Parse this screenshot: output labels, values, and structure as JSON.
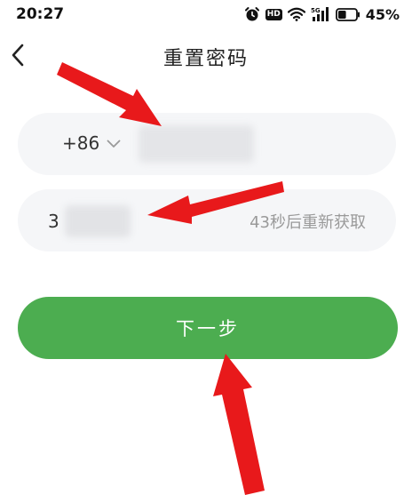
{
  "status_bar": {
    "time": "20:27",
    "network": "5G",
    "hd_label": "HD",
    "battery_percent": "45%",
    "battery_level": 0.45,
    "icons": [
      "alarm-icon",
      "hd-icon",
      "wifi-icon",
      "signal-icon",
      "battery-icon"
    ]
  },
  "header": {
    "title": "重置密码",
    "back_icon": "chevron-left-icon"
  },
  "phone_field": {
    "country_code": "+86",
    "dropdown_icon": "chevron-down-icon",
    "value_obscured": true
  },
  "code_field": {
    "value_visible_prefix": "3",
    "value_obscured": true,
    "resend_countdown_text": "43秒后重新获取"
  },
  "next_button": {
    "label": "下一步",
    "color": "#4cad50"
  },
  "annotations": {
    "arrow_color": "#e8191b",
    "count": 3
  }
}
